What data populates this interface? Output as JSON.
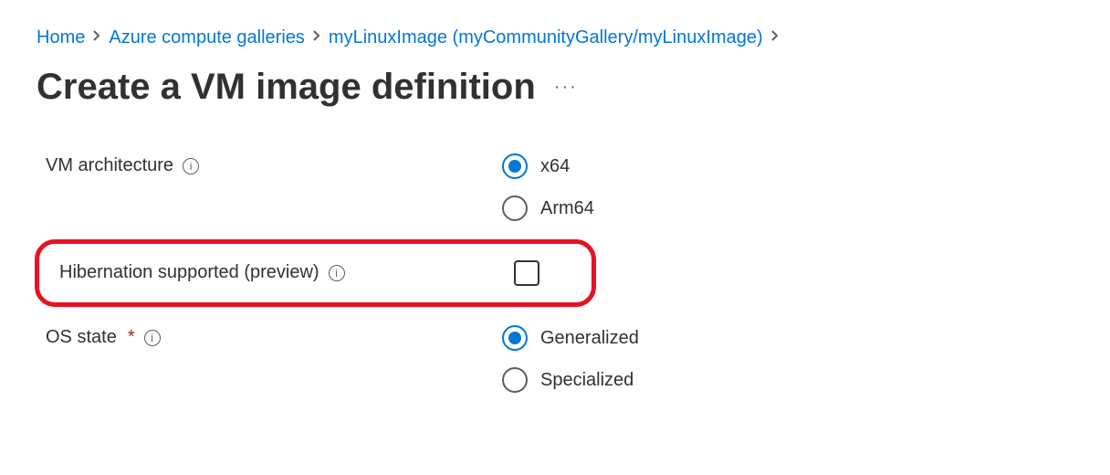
{
  "breadcrumb": {
    "home": "Home",
    "galleries": "Azure compute galleries",
    "image": "myLinuxImage (myCommunityGallery/myLinuxImage)"
  },
  "title": "Create a VM image definition",
  "fields": {
    "architecture": {
      "label": "VM architecture",
      "options": [
        {
          "label": "x64",
          "checked": true
        },
        {
          "label": "Arm64",
          "checked": false
        }
      ]
    },
    "hibernation": {
      "label": "Hibernation supported (preview)",
      "checked": false
    },
    "osState": {
      "label": "OS state",
      "required": "*",
      "options": [
        {
          "label": "Generalized",
          "checked": true
        },
        {
          "label": "Specialized",
          "checked": false
        }
      ]
    }
  }
}
